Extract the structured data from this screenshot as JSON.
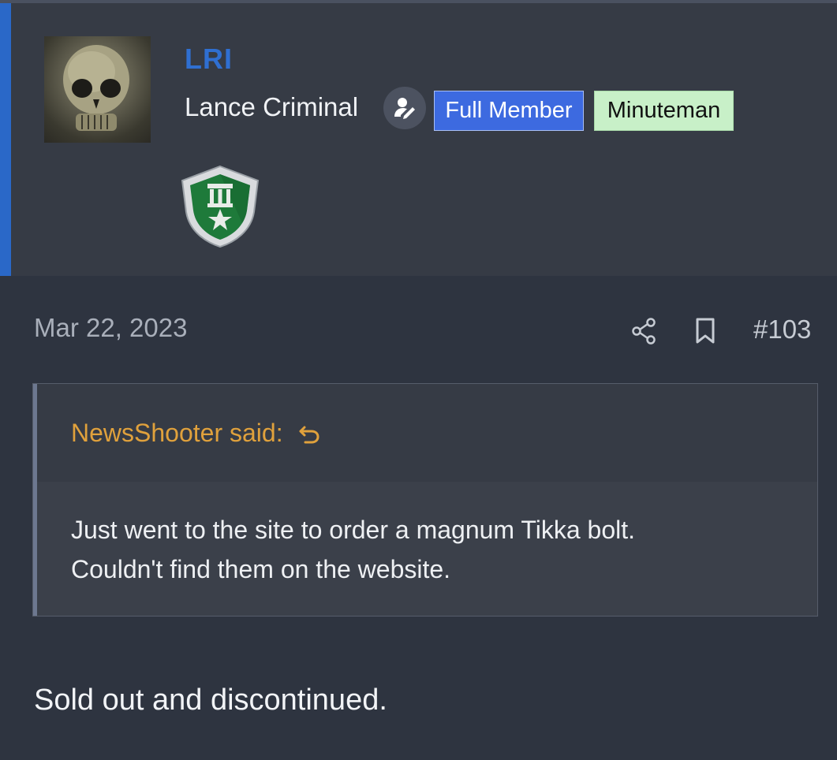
{
  "user": {
    "username": "LRI",
    "title": "Lance Criminal",
    "badges": [
      {
        "label": "Full Member",
        "bg": "#3d6ae0"
      },
      {
        "label": "Minuteman",
        "bg": "#c8f0c8"
      }
    ],
    "staff_icon": "user-edit-icon",
    "trophy_icon": "trophy-shield-icon",
    "accent_color": "#2a68c8"
  },
  "post": {
    "date": "Mar 22, 2023",
    "number": "#103",
    "actions": [
      "share-icon",
      "bookmark-icon"
    ],
    "quote": {
      "author_line": "NewsShooter said:",
      "body_line1": "Just went to the site to order a magnum Tikka bolt.",
      "body_line2": "Couldn't find them on the website."
    },
    "text": "Sold out and discontinued."
  }
}
